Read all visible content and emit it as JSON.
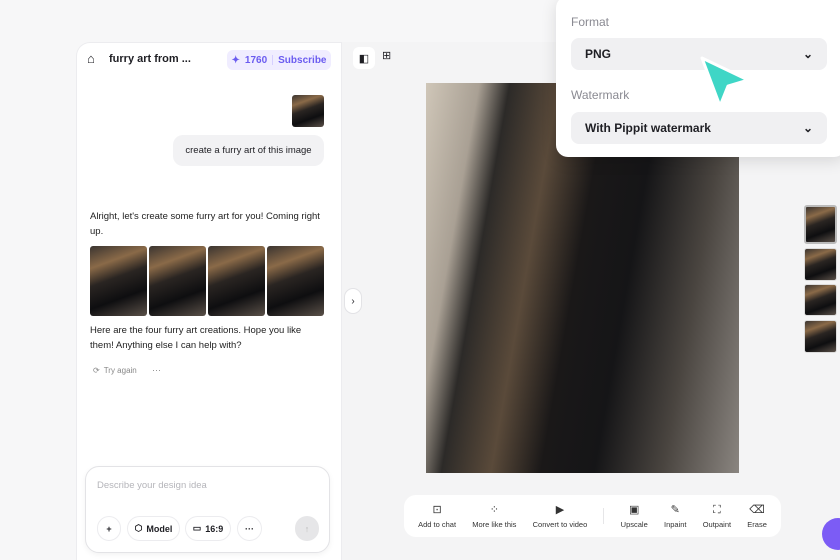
{
  "header": {
    "title": "furry art from ...",
    "credits": "1760",
    "subscribe": "Subscribe"
  },
  "chat": {
    "user_message": "create a furry art of this image",
    "reply_1": "Alright, let's create some furry art for you! Coming right up.",
    "reply_2": "Here are the four furry art creations. Hope you like them! Anything else I can help with?",
    "try_again": "Try again",
    "more": "···"
  },
  "input": {
    "placeholder": "Describe your design idea",
    "model": "Model",
    "ratio": "16:9",
    "more": "···"
  },
  "toolbar": [
    "Add to chat",
    "More like this",
    "Convert to video",
    "Upscale",
    "Inpaint",
    "Outpaint",
    "Erase"
  ],
  "export": {
    "format_label": "Format",
    "format_value": "PNG",
    "watermark_label": "Watermark",
    "watermark_value": "With Pippit watermark"
  },
  "colors": {
    "accent": "#6b5cf0",
    "cursor": "#3fd6c6"
  }
}
